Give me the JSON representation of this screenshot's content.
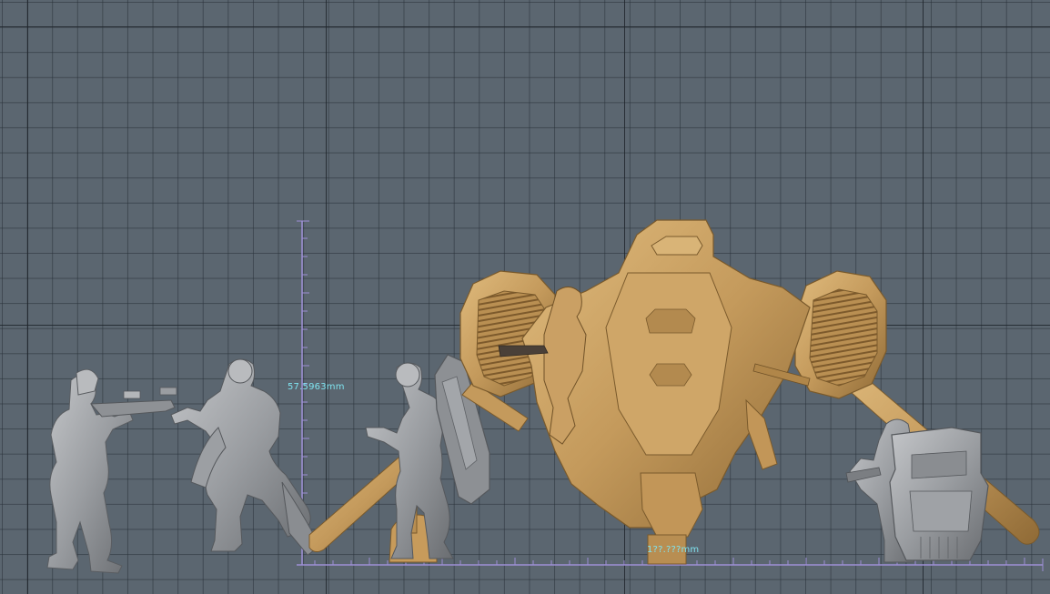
{
  "viewport": {
    "background": "#5b6670",
    "grid_color": "#2a3139",
    "ruler_color": "#9e8fd6"
  },
  "measurements": {
    "height_label": "57.5963mm",
    "width_label": "1??.???mm"
  },
  "models": [
    {
      "name": "soldier-aiming-rifle",
      "material": "grey"
    },
    {
      "name": "armored-soldier-pointing-pistol",
      "material": "grey"
    },
    {
      "name": "soldier-with-riot-shield",
      "material": "grey"
    },
    {
      "name": "dropship-walker-with-pilot",
      "material": "tan"
    },
    {
      "name": "soldier-kneeling-behind-crate",
      "material": "grey"
    }
  ],
  "colors": {
    "grey_model": "#a6a8ab",
    "grey_shadow": "#6c6f73",
    "tan_model": "#c9a062",
    "tan_shadow": "#8a6634",
    "label_cyan": "#7fe3ef"
  }
}
